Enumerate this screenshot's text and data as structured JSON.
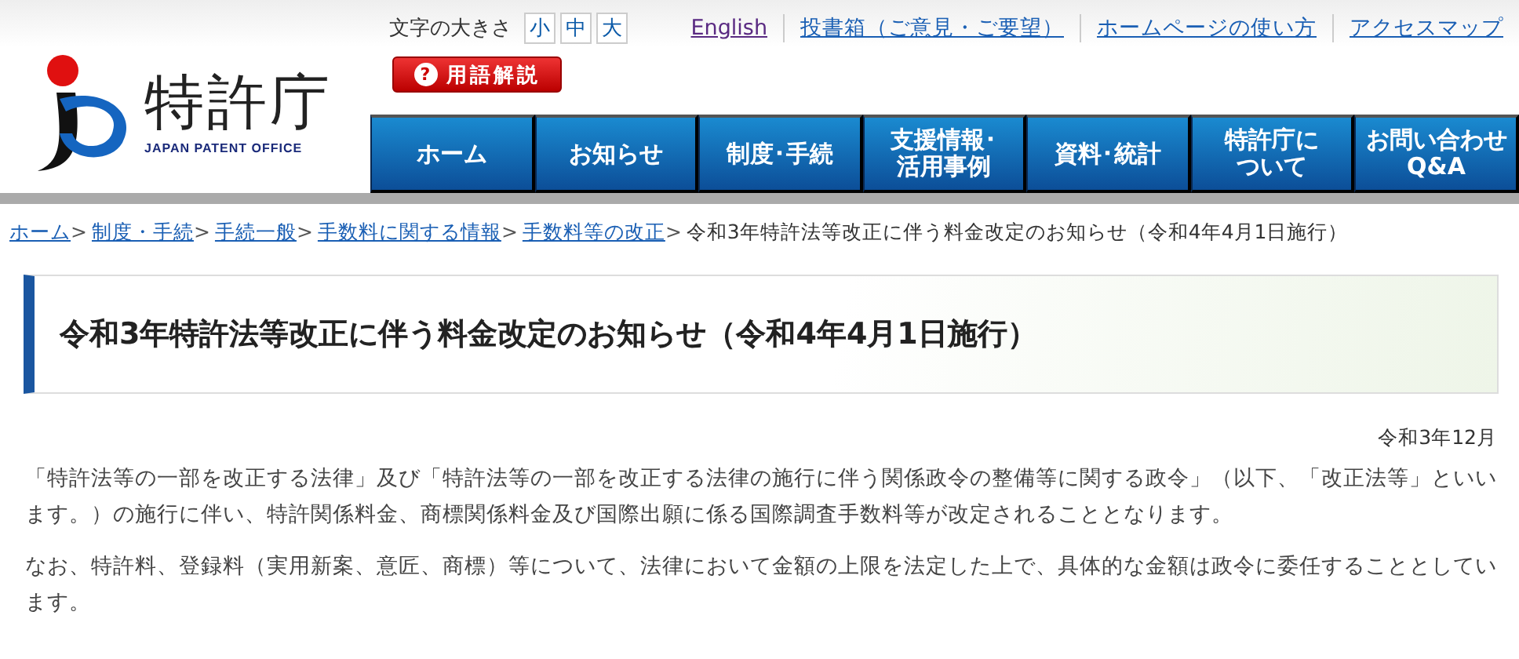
{
  "logo": {
    "name": "特許庁",
    "subtitle": "JAPAN PATENT OFFICE"
  },
  "font_size": {
    "label": "文字の大きさ",
    "options": [
      {
        "label": "小",
        "selected": false
      },
      {
        "label": "中",
        "selected": false
      },
      {
        "label": "大",
        "selected": false
      }
    ]
  },
  "glossary_button": {
    "icon": "?",
    "label": "用語解説"
  },
  "top_links": [
    {
      "label": "English",
      "visited": true
    },
    {
      "label": "投書箱（ご意見・ご要望）",
      "visited": false
    },
    {
      "label": "ホームページの使い方",
      "visited": false
    },
    {
      "label": "アクセスマップ",
      "visited": false
    }
  ],
  "nav": [
    {
      "lines": [
        "ホーム"
      ]
    },
    {
      "lines": [
        "お知らせ"
      ]
    },
    {
      "lines": [
        "制度･手続"
      ]
    },
    {
      "lines": [
        "支援情報･",
        "活用事例"
      ]
    },
    {
      "lines": [
        "資料･統計"
      ]
    },
    {
      "lines": [
        "特許庁に",
        "ついて"
      ]
    },
    {
      "lines": [
        "お問い合わせ",
        "Q&A"
      ]
    }
  ],
  "breadcrumb": [
    {
      "label": "ホーム",
      "link": true,
      "separator": ">"
    },
    {
      "label": "制度・手続",
      "link": true,
      "separator": ">"
    },
    {
      "label": "手続一般",
      "link": true,
      "separator": ">"
    },
    {
      "label": "手数料に関する情報",
      "link": true,
      "separator": ">"
    },
    {
      "label": "手数料等の改正",
      "link": true,
      "separator": ">"
    },
    {
      "label": "令和3年特許法等改正に伴う料金改定のお知らせ（令和4年4月1日施行）",
      "link": false
    }
  ],
  "page_title": "令和3年特許法等改正に伴う料金改定のお知らせ（令和4年4月1日施行）",
  "date": "令和3年12月",
  "paragraphs": [
    "「特許法等の一部を改正する法律」及び「特許法等の一部を改正する法律の施行に伴う関係政令の整備等に関する政令」（以下、「改正法等」といいます。）の施行に伴い、特許関係料金、商標関係料金及び国際出願に係る国際調査手数料等が改定されることとなります。",
    "なお、特許料、登録料（実用新案、意匠、商標）等について、法律において金額の上限を法定した上で、具体的な金額は政令に委任することとしています。"
  ]
}
